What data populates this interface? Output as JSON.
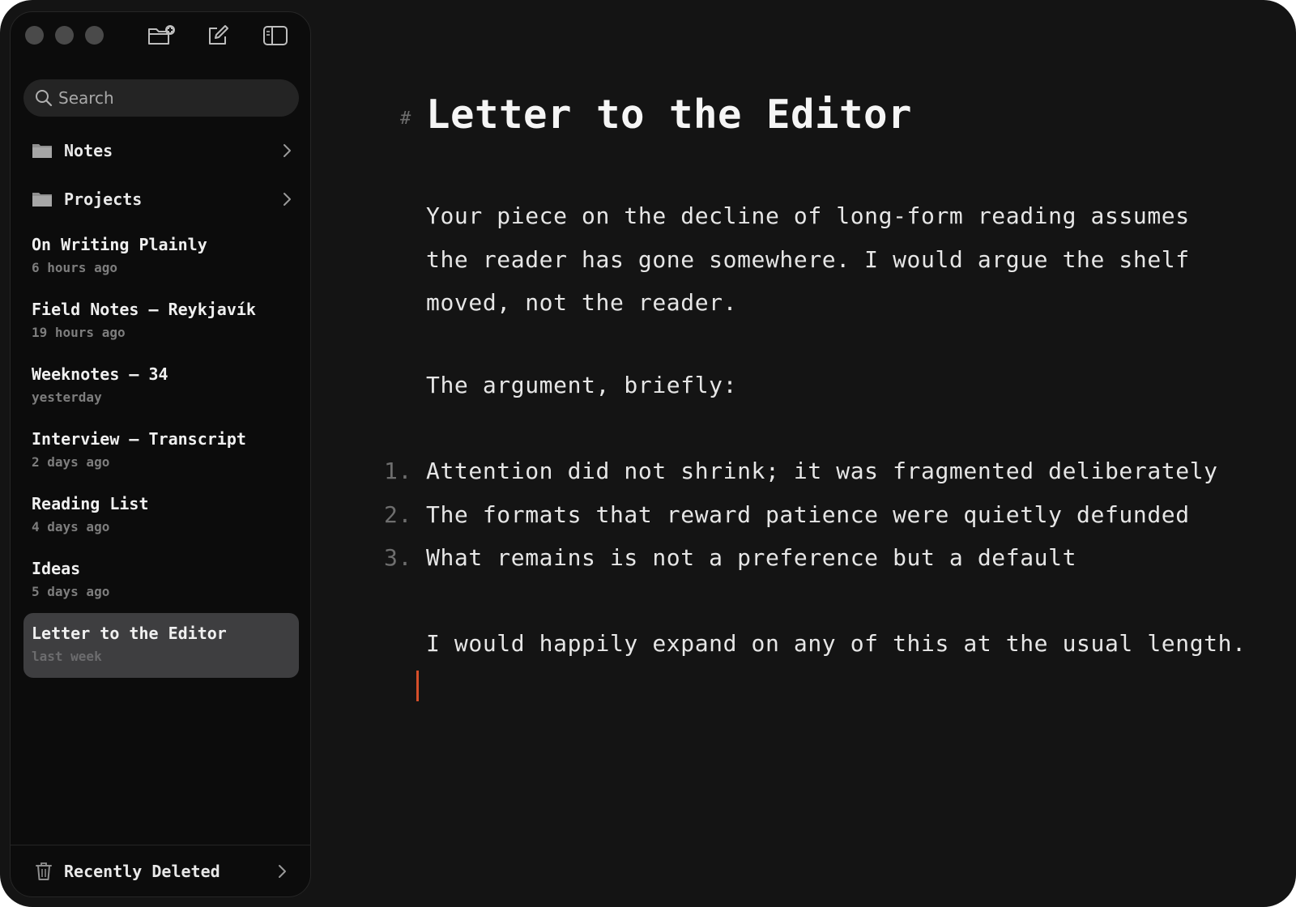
{
  "window": {
    "traffic_lights": [
      "close",
      "minimize",
      "zoom"
    ]
  },
  "toolbar": {
    "new_folder_icon": "folder-plus-icon",
    "compose_icon": "compose-icon",
    "sidebar_toggle_icon": "sidebar-toggle-icon"
  },
  "search": {
    "placeholder": "Search",
    "value": ""
  },
  "folders": [
    {
      "label": "Notes",
      "icon": "folder-icon"
    },
    {
      "label": "Projects",
      "icon": "folder-icon"
    }
  ],
  "notes": [
    {
      "title": "On Writing Plainly",
      "date": "6 hours ago"
    },
    {
      "title": "Field Notes — Reykjavík",
      "date": "19 hours ago"
    },
    {
      "title": "Weeknotes — 34",
      "date": "yesterday"
    },
    {
      "title": "Interview — Transcript",
      "date": "2 days ago"
    },
    {
      "title": "Reading List",
      "date": "4 days ago"
    },
    {
      "title": "Ideas",
      "date": "5 days ago"
    },
    {
      "title": "Letter to the Editor",
      "date": "last week",
      "selected": true
    }
  ],
  "footer": {
    "label": "Recently Deleted",
    "icon": "trash-icon"
  },
  "document": {
    "heading_mark": "#",
    "title": "Letter to the Editor",
    "paragraph1": "Your piece on the decline of long-form reading assumes the reader has gone somewhere. I would argue the shelf moved, not the reader.",
    "paragraph2": "The argument, briefly:",
    "list": [
      {
        "num": "1.",
        "text": "Attention did not shrink; it was fragmented deliberately"
      },
      {
        "num": "2.",
        "text": "The formats that reward patience were quietly defunded"
      },
      {
        "num": "3.",
        "text": "What remains is not a preference but a default"
      }
    ],
    "paragraph3": "I would happily expand on any of this at the usual length."
  },
  "colors": {
    "window_bg": "#141414",
    "sidebar_bg": "#0c0c0c",
    "selected_bg": "#3e3e40",
    "caret": "#d64f2a",
    "muted": "#6e6e6e"
  }
}
